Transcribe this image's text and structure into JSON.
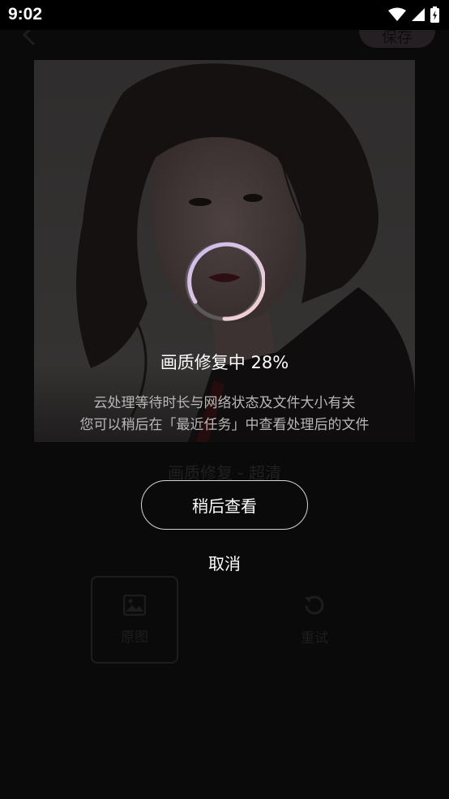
{
  "status_bar": {
    "time": "9:02"
  },
  "header": {
    "save_label": "保存"
  },
  "photo": {
    "alt": "portrait"
  },
  "photo_title": "画质修复 - 超清",
  "tools": [
    {
      "label": "原图",
      "icon": "image-icon"
    },
    {
      "label": "重试",
      "icon": "refresh-icon"
    }
  ],
  "loading": {
    "title": "画质修复中",
    "percent_text": "28%",
    "progress": 0.28,
    "hint_line1": "云处理等待时长与网络状态及文件大小有关",
    "hint_line2": "您可以稍后在「最近任务」中查看处理后的文件"
  },
  "actions": {
    "later_label": "稍后查看",
    "cancel_label": "取消"
  }
}
